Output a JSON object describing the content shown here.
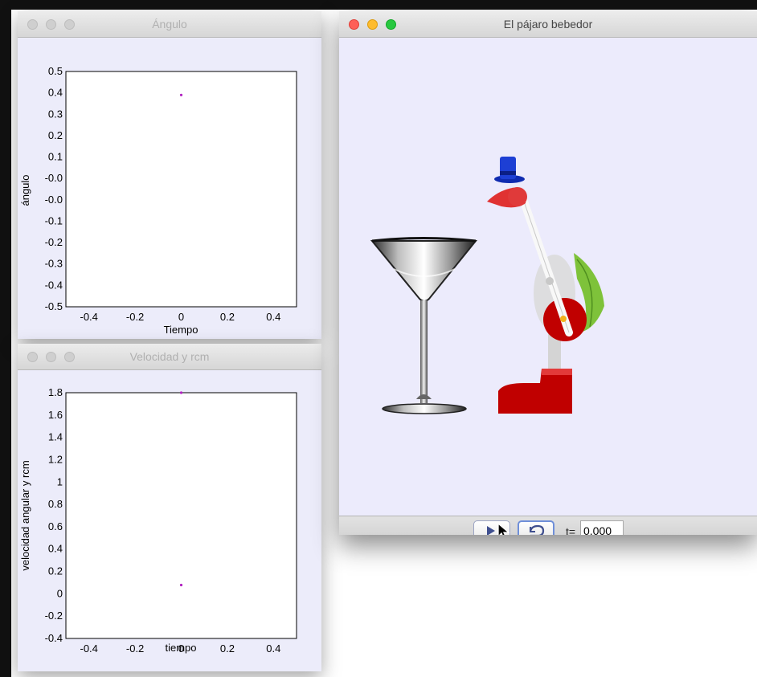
{
  "windows": {
    "angle": {
      "title": "Ángulo",
      "xlabel": "Tiempo",
      "ylabel": "ángulo"
    },
    "velocity": {
      "title": "Velocidad y rcm",
      "xlabel": "tiempo",
      "ylabel": "velocidad angular y rcm"
    },
    "bird": {
      "title": "El pájaro bebedor",
      "time_label": "t=",
      "time_value": "0.000"
    }
  },
  "chart_data": [
    {
      "type": "scatter",
      "title": "Ángulo",
      "xlabel": "Tiempo",
      "ylabel": "ángulo",
      "xlim": [
        -0.5,
        0.5
      ],
      "ylim": [
        -0.5,
        0.5
      ],
      "xticks": [
        "-0.4",
        "-0.2",
        "0",
        "0.2",
        "0.4"
      ],
      "yticks": [
        "0.5",
        "0.4",
        "0.3",
        "0.2",
        "0.1",
        "-0.0",
        "-0.0",
        "-0.1",
        "-0.2",
        "-0.3",
        "-0.4",
        "-0.5"
      ],
      "grid": true,
      "x": [
        0
      ],
      "y": [
        0.4
      ]
    },
    {
      "type": "scatter",
      "title": "Velocidad y rcm",
      "xlabel": "tiempo",
      "ylabel": "velocidad angular y rcm",
      "xlim": [
        -0.5,
        0.5
      ],
      "ylim": [
        -0.5,
        1.8
      ],
      "xticks": [
        "-0.4",
        "-0.2",
        "0",
        "0.2",
        "0.4"
      ],
      "yticks": [
        "1.8",
        "1.6",
        "1.4",
        "1.2",
        "1",
        "0.8",
        "0.6",
        "0.4",
        "0.2",
        "0",
        "-0.2",
        "-0.4"
      ],
      "grid": true,
      "x": [
        0,
        0
      ],
      "y": [
        1.8,
        0
      ]
    }
  ],
  "colors": {
    "window_bg": "#ececfa",
    "scene_bg": "#ecebfc",
    "bird_red": "#c00000",
    "hat_blue": "#1534c8",
    "feather_green": "#7ec23a"
  },
  "icons": {
    "play": "play-icon",
    "reset": "reset-icon"
  }
}
